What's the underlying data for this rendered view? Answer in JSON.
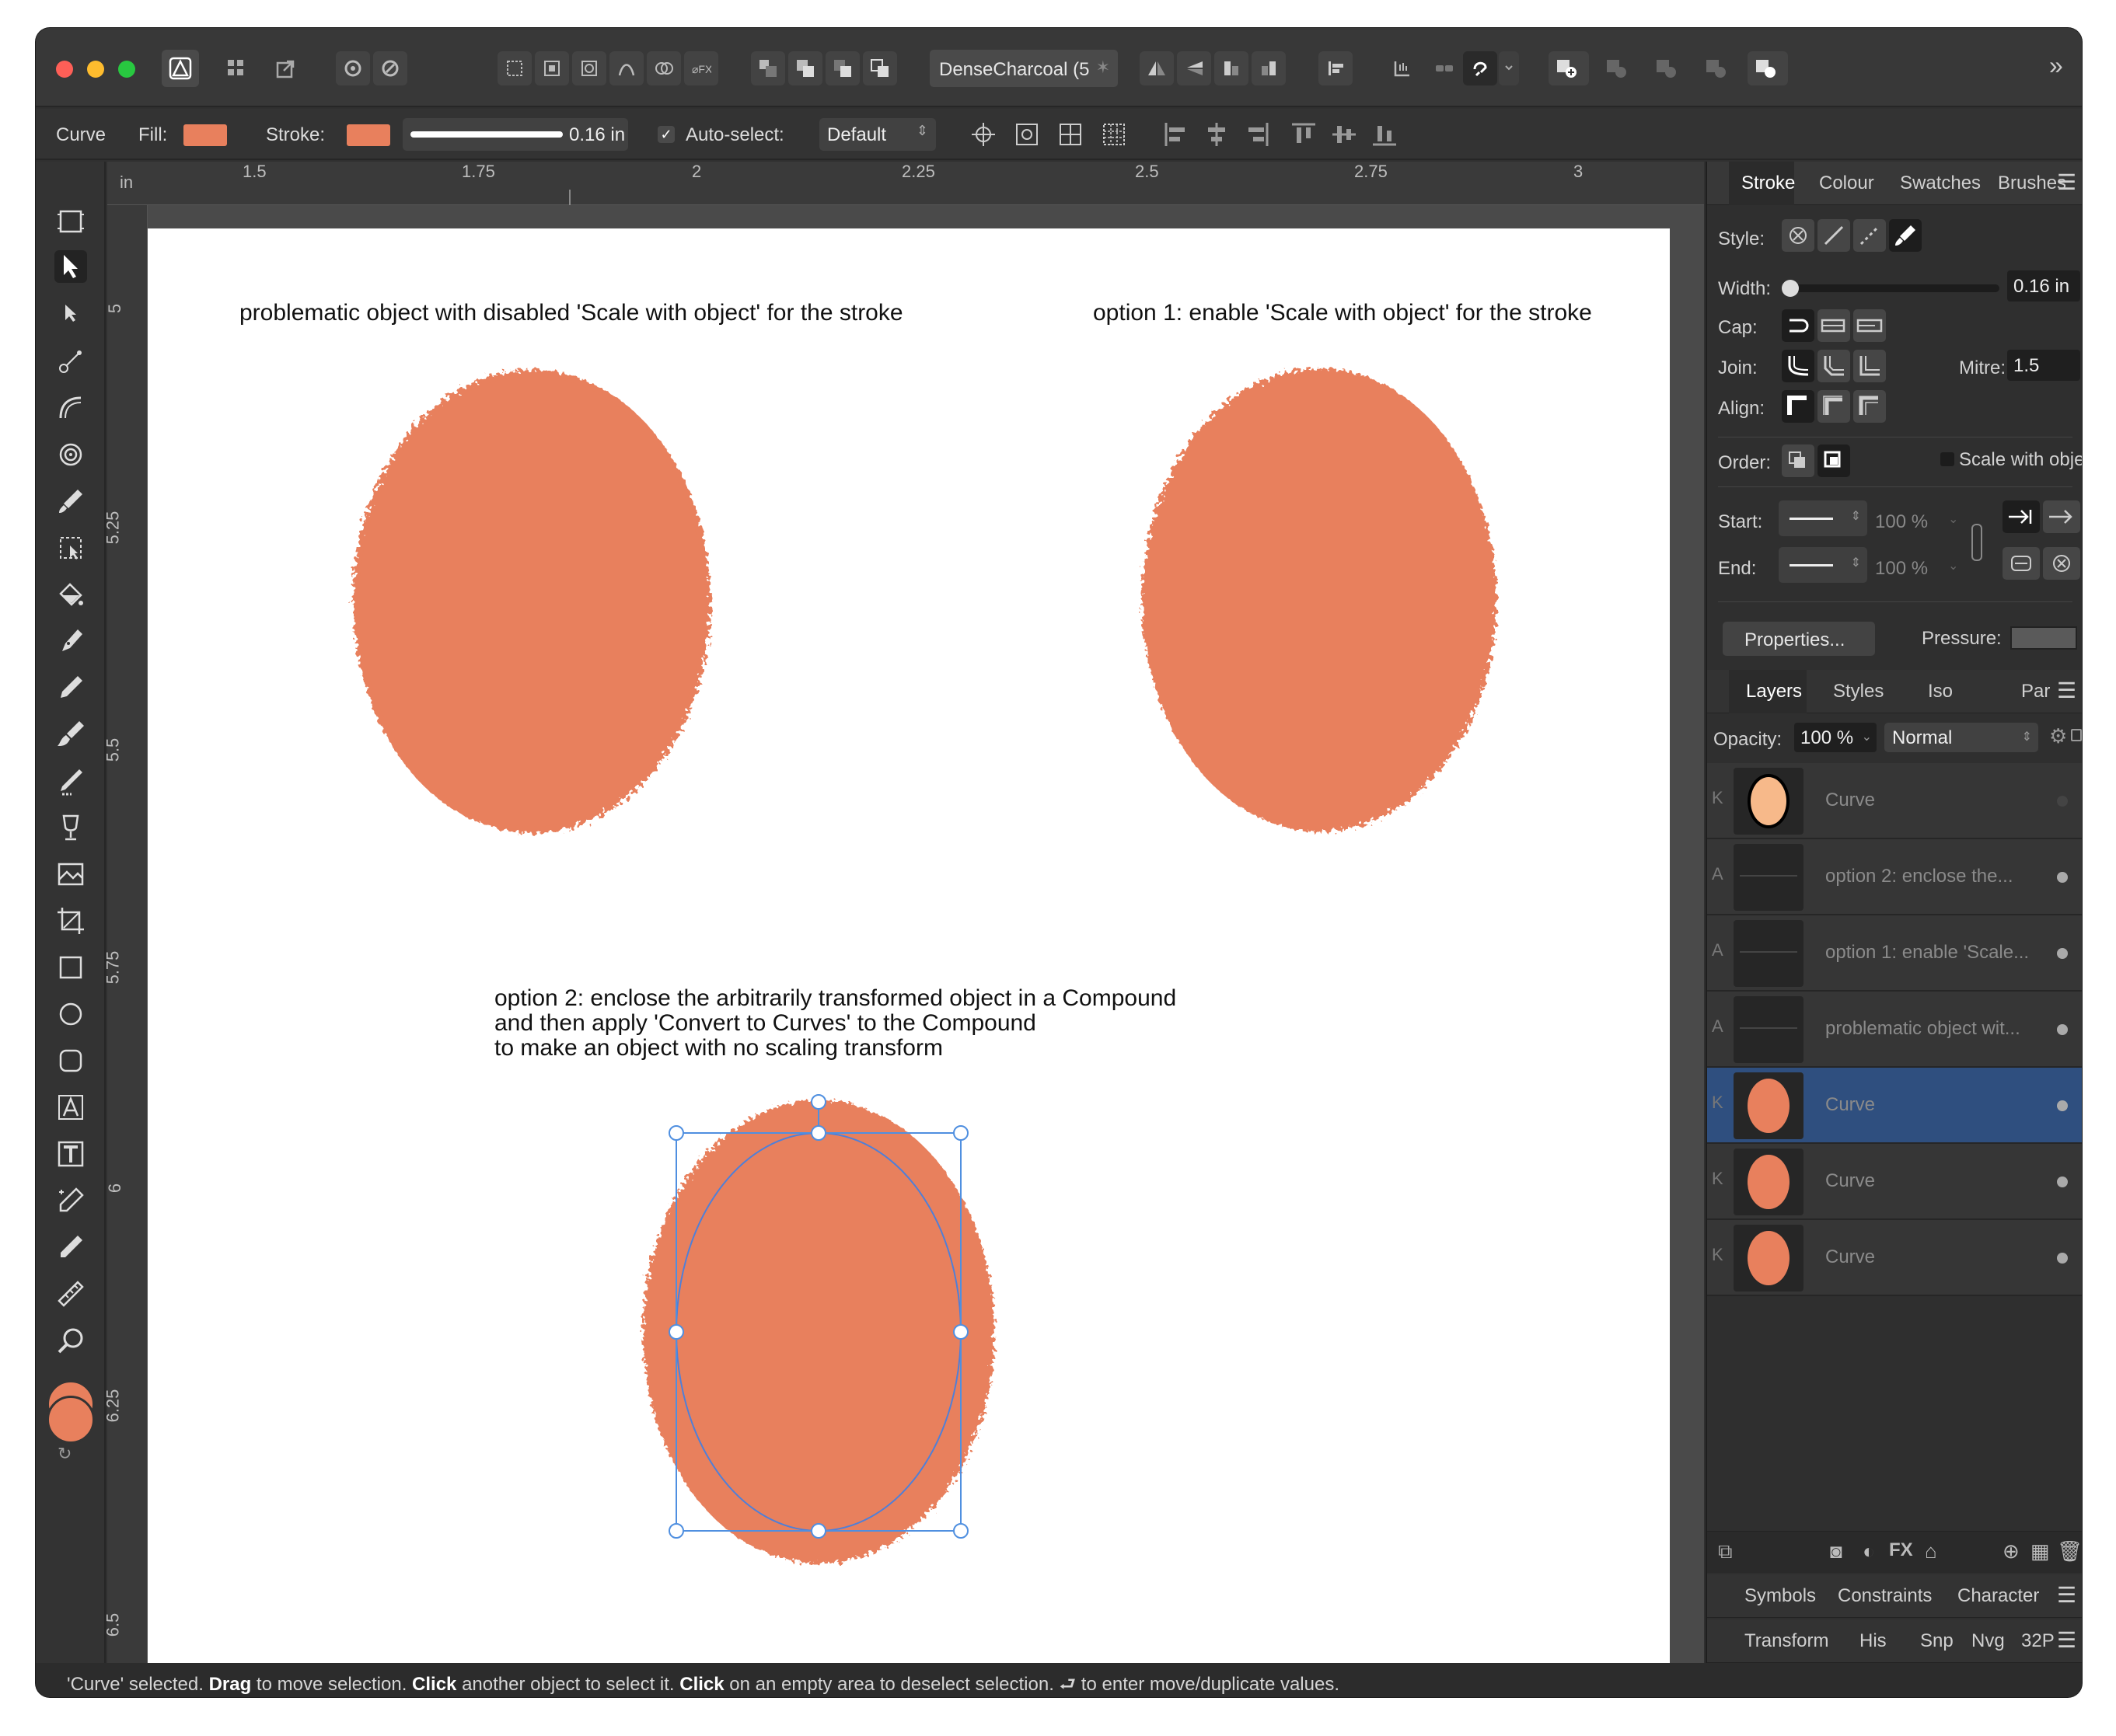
{
  "toolbar": {
    "preset": "DenseCharcoal (5",
    "preset_icon": "star-icon"
  },
  "context": {
    "object": "Curve",
    "fill_label": "Fill:",
    "fill_color": "#e8805d",
    "stroke_label": "Stroke:",
    "stroke_color": "#e8805d",
    "stroke_width": "0.16 in",
    "autoselect_label": "Auto-select:",
    "autoselect_value": "Default"
  },
  "ruler": {
    "unit": "in",
    "top_ticks": [
      "1.5",
      "1.75",
      "2",
      "2.25",
      "2.5",
      "2.75",
      "3"
    ],
    "left_ticks": [
      "5",
      "5.25",
      "5.5",
      "5.75",
      "6",
      "6.25",
      "6.5"
    ]
  },
  "canvas": {
    "note1": "problematic object with disabled 'Scale with object' for the stroke",
    "note2": "option 1: enable 'Scale with object' for the stroke",
    "note3_l1": "option 2: enclose the arbitrarily transformed object in a Compound",
    "note3_l2": "and then apply 'Convert to Curves' to the Compound",
    "note3_l3": "to make an object with no scaling transform",
    "shape_color": "#e8805d"
  },
  "stroke_panel": {
    "tabs": [
      "Stroke",
      "Colour",
      "Swatches",
      "Brushes"
    ],
    "style_label": "Style:",
    "width_label": "Width:",
    "width_value": "0.16 in",
    "cap_label": "Cap:",
    "join_label": "Join:",
    "mitre_label": "Mitre:",
    "mitre_value": "1.5",
    "align_label": "Align:",
    "order_label": "Order:",
    "scale_label": "Scale with object",
    "start_label": "Start:",
    "start_pct": "100 %",
    "end_label": "End:",
    "end_pct": "100 %",
    "properties_btn": "Properties...",
    "pressure_label": "Pressure:"
  },
  "layers_panel": {
    "tabs": [
      "Layers",
      "Styles",
      "Iso",
      "Par"
    ],
    "opacity_label": "Opacity:",
    "opacity_value": "100 %",
    "blend_mode": "Normal",
    "items": [
      {
        "name": "Curve",
        "kind": "K",
        "thumb": "peach"
      },
      {
        "name": "option 2: enclose the...",
        "kind": "A",
        "thumb": "text"
      },
      {
        "name": "option 1: enable 'Scale...",
        "kind": "A",
        "thumb": "text"
      },
      {
        "name": "problematic object wit...",
        "kind": "A",
        "thumb": "text"
      },
      {
        "name": "Curve",
        "kind": "K",
        "thumb": "orange",
        "selected": true
      },
      {
        "name": "Curve",
        "kind": "K",
        "thumb": "orange"
      },
      {
        "name": "Curve",
        "kind": "K",
        "thumb": "orange"
      }
    ]
  },
  "bottom_tabs1": [
    "Symbols",
    "Constraints",
    "Character"
  ],
  "bottom_tabs2": [
    "Transform",
    "His",
    "Snp",
    "Nvg",
    "32P"
  ],
  "status": {
    "p1": "'Curve' selected. ",
    "b1": "Drag",
    "p2": " to move selection. ",
    "b2": "Click",
    "p3": " another object to select it. ",
    "b3": "Click",
    "p4": " on an empty area to deselect selection. ",
    "p5": " to enter move/duplicate values."
  }
}
